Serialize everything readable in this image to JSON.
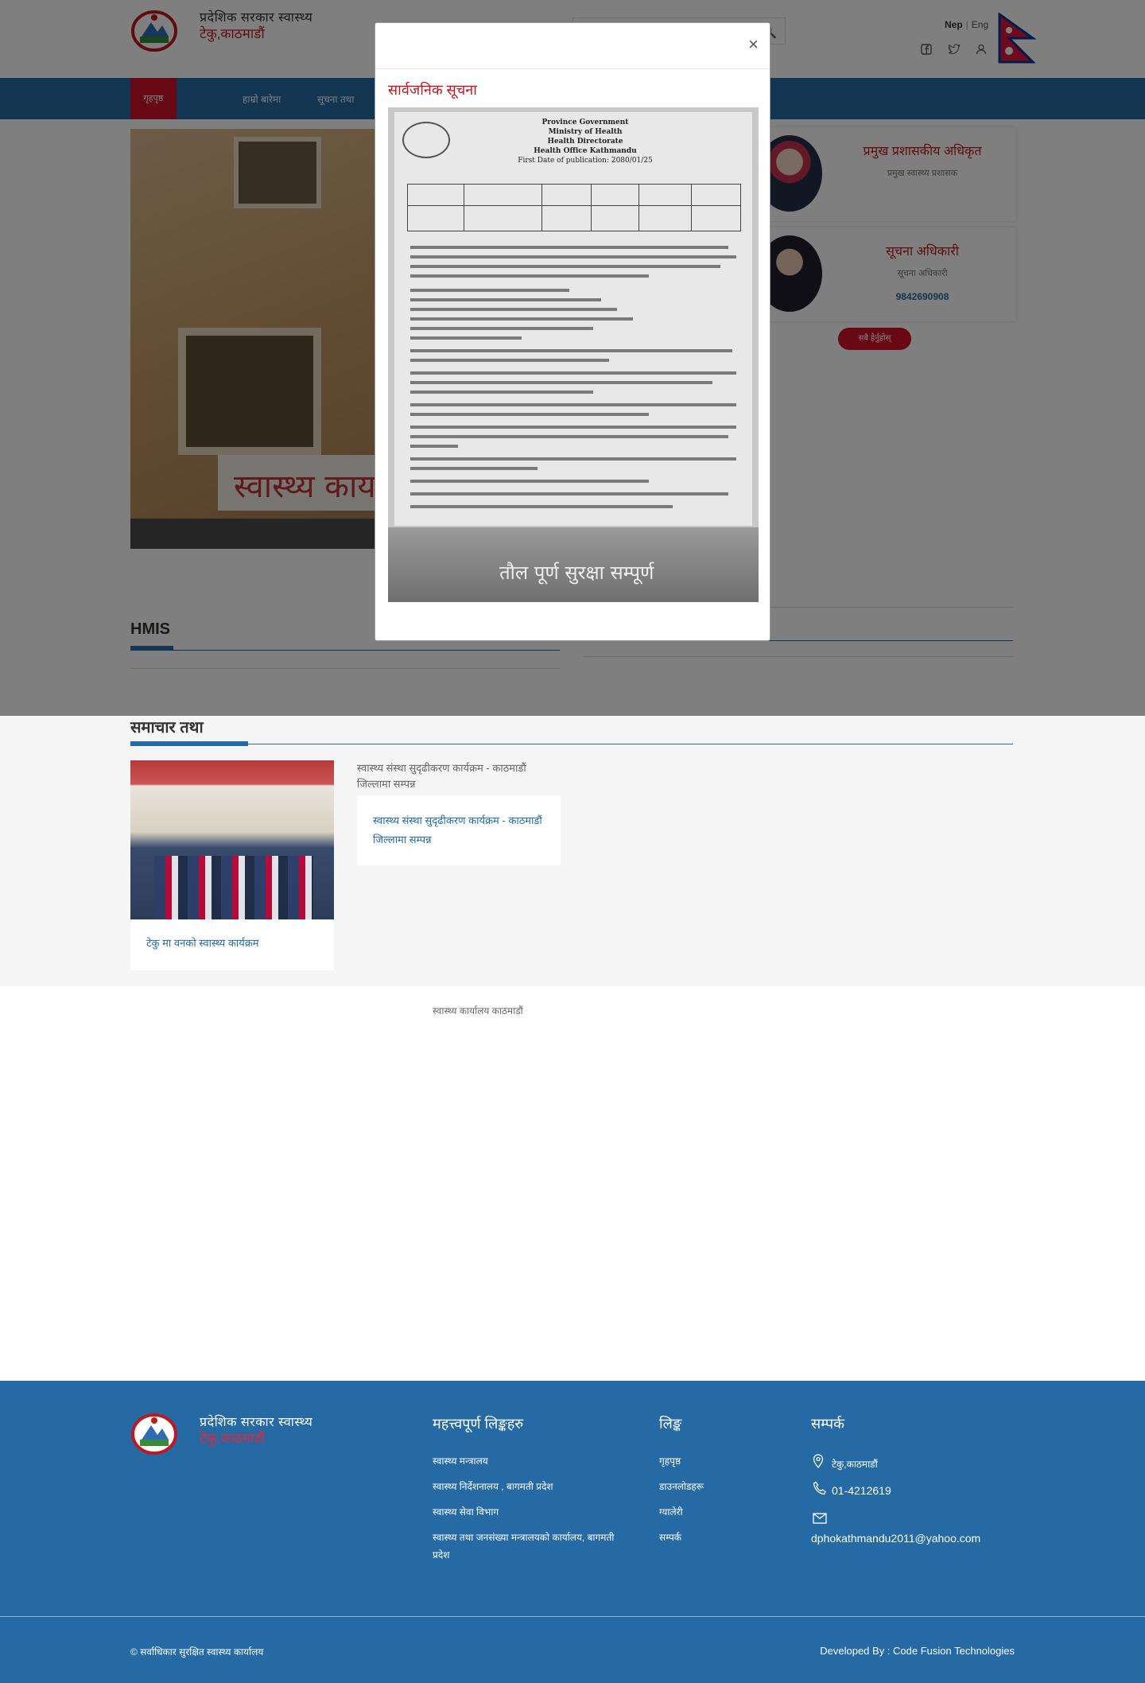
{
  "header": {
    "org_title": "प्रदेशिक सरकार स्वास्थ्य",
    "org_subtitle": "टेकु,काठमाडौं",
    "lang_nep": "Nep",
    "lang_sep": "|",
    "lang_eng": "Eng"
  },
  "nav": {
    "items": [
      "गृहपृष्ठ",
      "हाम्रो बारेमा",
      "सूचना तथा"
    ]
  },
  "officials": [
    {
      "name": "प्रमुख प्रशासकीय अधिकृत",
      "role": "प्रमुख स्वास्थ्य प्रशासक",
      "phone": ""
    },
    {
      "name": "सूचना अधिकारी",
      "role": "सूचना अधिकारी",
      "phone": "9842690908"
    }
  ],
  "officials_all_button": "सबै हेर्नुहोस्",
  "sections": {
    "hmis_title": "HMIS",
    "news_title": "समाचार तथा"
  },
  "news": [
    {
      "caption": "टेकु मा वनको स्वास्थ्य कार्यक्रम",
      "img_alt": ""
    },
    {
      "caption": "स्वास्थ्य संस्था सुदृढीकरण कार्यक्रम - काठमाडौं जिल्लामा सम्पन्न",
      "img_alt": "स्वास्थ्य संस्था सुदृढीकरण कार्यक्रम - काठमाडौं जिल्लामा सम्पन्न"
    }
  ],
  "widget_title": "स्वास्थ्य कार्यालय काठमाडौं",
  "modal": {
    "close": "×",
    "title": "सार्वजनिक सूचना",
    "notice_heading": [
      "Province Government",
      "Ministry of Health",
      "Health Directorate",
      "Health Office Kathmandu",
      "First Date of publication: 2080/01/25"
    ],
    "ad_text": "तौल पूर्ण सुरक्षा सम्पूर्ण"
  },
  "footer": {
    "org_title": "प्रदेशिक सरकार स्वास्थ्य",
    "org_subtitle": "टेकु,काठमाडौं",
    "col1_head": "महत्त्वपूर्ण लिङ्कहरु",
    "col1_links": [
      "स्वास्थ्य मन्त्रालय",
      "स्वास्थ्य निर्देशनालय , बागमती प्रदेश",
      "स्वास्थ्य सेवा विभाग",
      "स्वास्थ्य तथा जनसंख्या मन्त्रालयको कार्यालय, बागमती प्रदेश"
    ],
    "col2_head": "लिङ्क",
    "col2_links": [
      "गृहपृष्ठ",
      "डाउनलोडहरू",
      "ग्यालेरी",
      "सम्पर्क"
    ],
    "col3_head": "सम्पर्क",
    "address": "टेकु,काठमाडौं",
    "phone": "01-4212619",
    "email": "dphokathmandu2011@yahoo.com",
    "copyright": "© सर्वाधिकार सुरक्षित स्वास्थ्य कार्यालय",
    "developer": "Developed By : Code Fusion Technologies"
  },
  "colors": {
    "brand_blue": "#256aa5",
    "accent_red": "#d0102a",
    "overlay": "rgba(0,0,0,0.5)"
  },
  "icons": [
    "search-icon",
    "facebook-icon",
    "twitter-icon",
    "user-icon",
    "close-icon",
    "location-icon",
    "phone-icon",
    "mail-icon"
  ]
}
